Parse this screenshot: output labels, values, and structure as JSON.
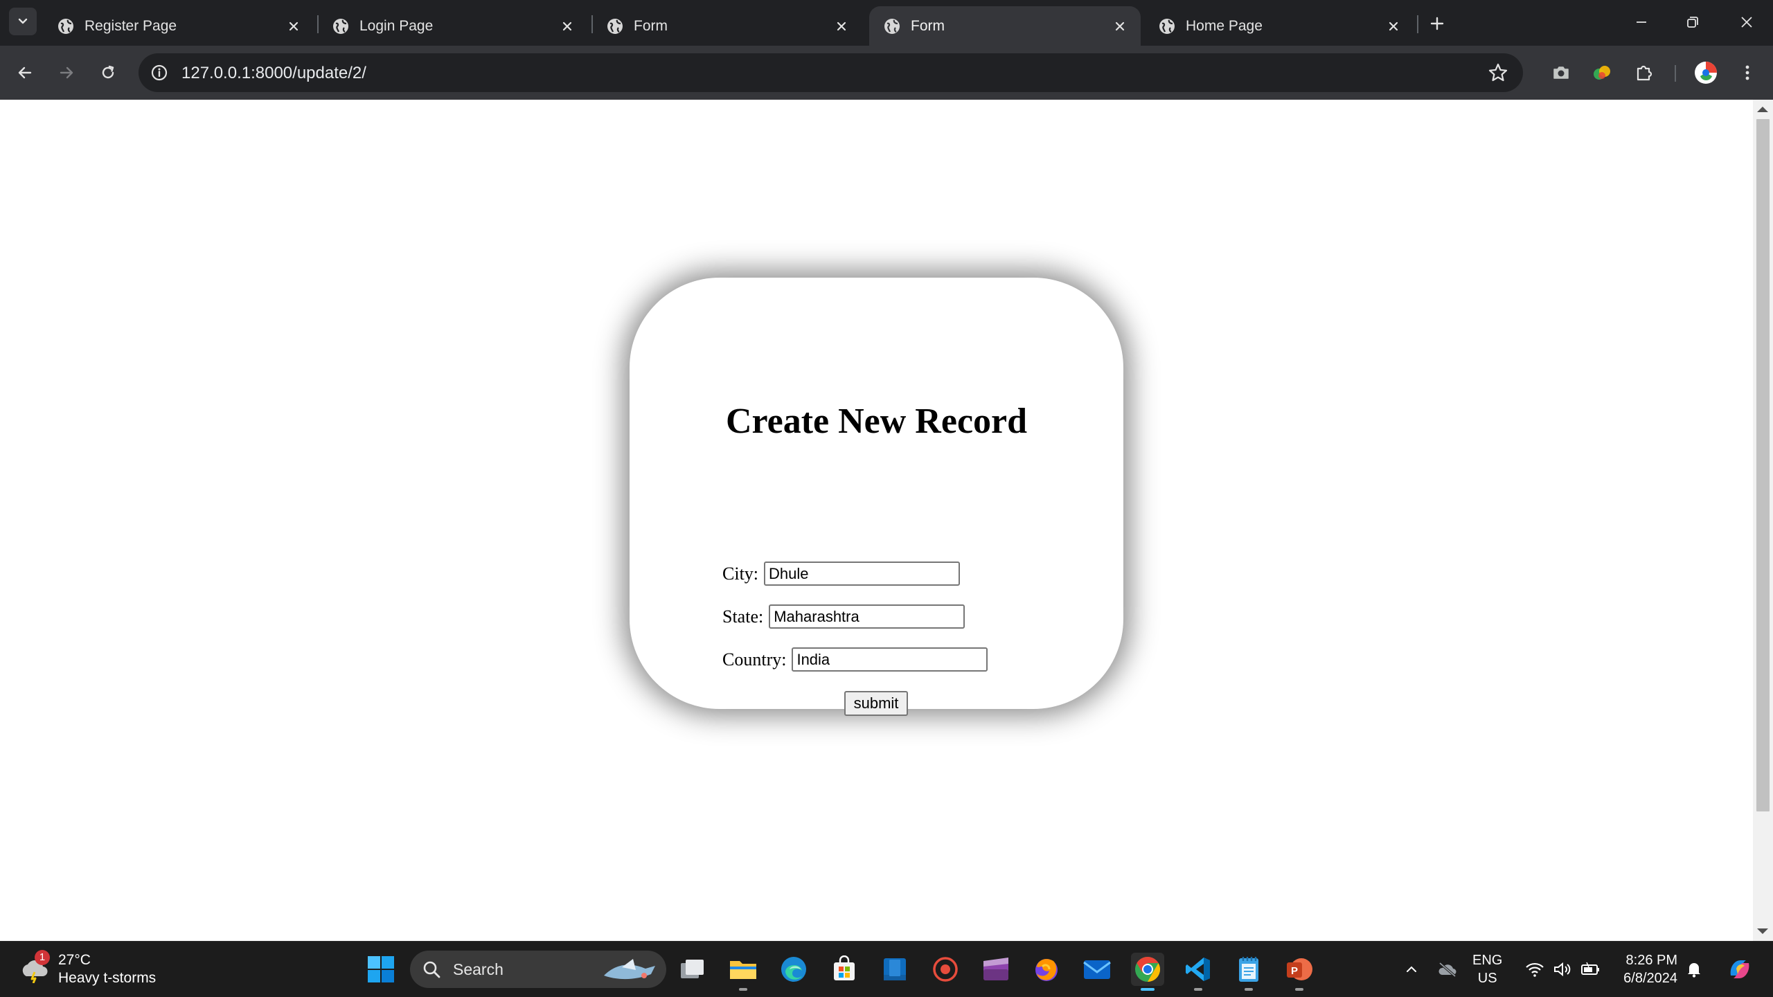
{
  "browser": {
    "tabs": [
      {
        "title": "Register Page",
        "active": false
      },
      {
        "title": "Login Page",
        "active": false
      },
      {
        "title": "Form",
        "active": false
      },
      {
        "title": "Form",
        "active": true
      },
      {
        "title": "Home Page",
        "active": false
      }
    ],
    "address_bar": {
      "url": "127.0.0.1:8000/update/2/"
    }
  },
  "page": {
    "heading": "Create New Record",
    "fields": [
      {
        "label": "City:",
        "value": "Dhule"
      },
      {
        "label": "State:",
        "value": "Maharashtra"
      },
      {
        "label": "Country:",
        "value": "India"
      }
    ],
    "submit_label": "submit"
  },
  "taskbar": {
    "weather": {
      "temperature": "27°C",
      "condition": "Heavy t-storms",
      "badge": "1"
    },
    "search_label": "Search",
    "language": {
      "line1": "ENG",
      "line2": "US"
    },
    "clock": {
      "time": "8:26 PM",
      "date": "6/8/2024"
    }
  },
  "colors": {
    "tab_strip": "#202124",
    "toolbar": "#35363a",
    "taskbar": "#1c1c1c",
    "accent": "#4cc2ff"
  }
}
